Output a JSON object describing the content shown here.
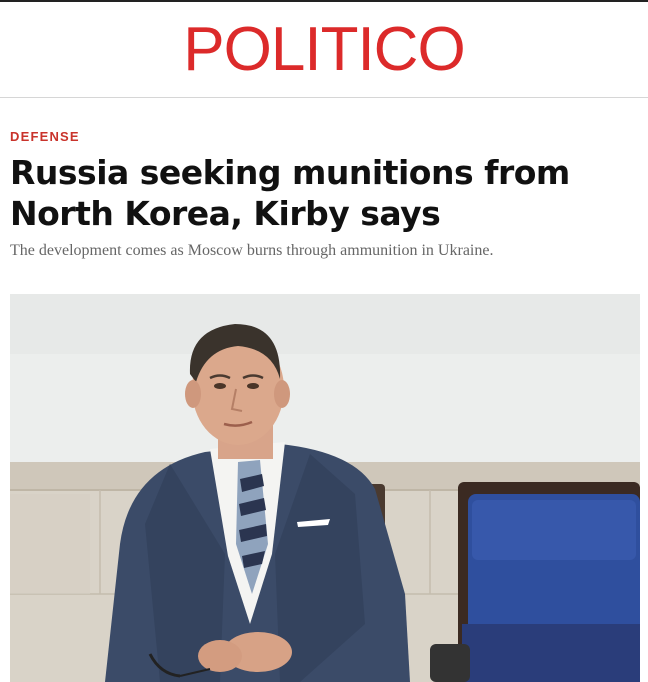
{
  "site": {
    "logo_text": "POLITICO",
    "brand_color": "#dc2a2a"
  },
  "article": {
    "kicker": "DEFENSE",
    "headline": "Russia seeking munitions from North Korea, Kirby says",
    "dek": "The development comes as Moscow burns through ammunition in Ukraine."
  },
  "colors": {
    "kicker": "#c9332b",
    "chair_blue": "#2f4f9e",
    "suit": "#3a4a66",
    "wall": "#ebeeec"
  }
}
